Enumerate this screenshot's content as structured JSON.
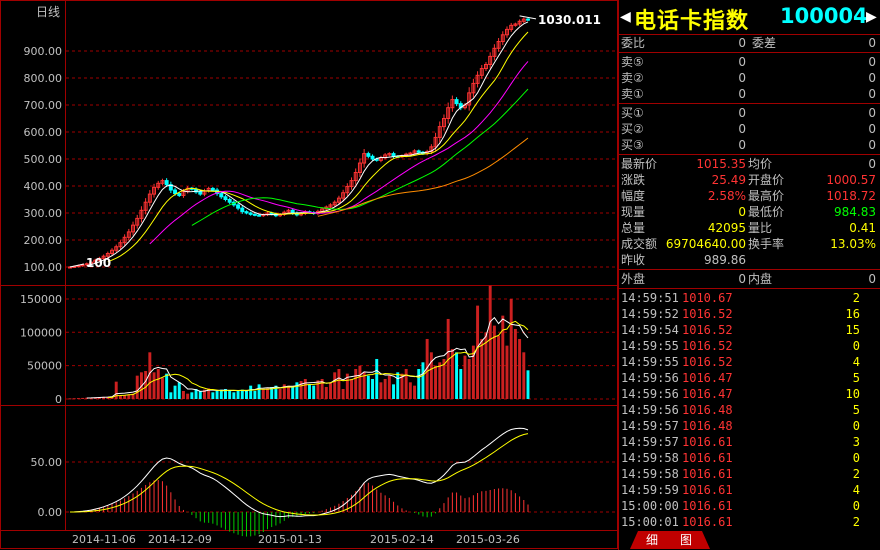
{
  "chart": {
    "period_label": "日线",
    "price_axis": [
      "900.00",
      "800.00",
      "700.00",
      "600.00",
      "500.00",
      "400.00",
      "300.00",
      "200.00",
      "100.00"
    ],
    "vol_axis": [
      "150000",
      "100000",
      "50000",
      "0"
    ],
    "macd_axis": [
      "50.00",
      "0.00"
    ],
    "dates": [
      "2014-11-06",
      "2014-12-09",
      "2015-01-13",
      "2015-02-14",
      "2015-03-26"
    ],
    "max_label": "1030.011",
    "min_label": "100",
    "colors": {
      "up": "#ff3333",
      "down": "#00ffff",
      "ma5": "#ffffff",
      "ma10": "#ffff00",
      "ma20": "#ff00ff",
      "ma30": "#00ff00",
      "ma60": "#ff8c00",
      "grid": "#a00000"
    }
  },
  "chart_data": {
    "type": "candlestick",
    "title": "日线",
    "close": [
      100,
      102,
      105,
      108,
      112,
      118,
      125,
      132,
      140,
      150,
      162,
      175,
      190,
      210,
      230,
      255,
      280,
      310,
      340,
      370,
      395,
      410,
      420,
      405,
      385,
      372,
      365,
      380,
      392,
      388,
      378,
      370,
      382,
      391,
      385,
      372,
      360,
      350,
      340,
      330,
      318,
      305,
      300,
      295,
      292,
      290,
      294,
      300,
      296,
      290,
      295,
      303,
      310,
      300,
      293,
      298,
      305,
      302,
      298,
      306,
      315,
      322,
      330,
      340,
      355,
      375,
      398,
      420,
      450,
      485,
      520,
      510,
      500,
      495,
      505,
      515,
      520,
      510,
      508,
      512,
      518,
      522,
      530,
      525,
      520,
      528,
      545,
      580,
      620,
      650,
      690,
      720,
      705,
      690,
      700,
      745,
      780,
      810,
      835,
      850,
      880,
      910,
      935,
      960,
      980,
      995,
      1000,
      1010,
      1018,
      1015
    ],
    "vol": [
      1000,
      1200,
      1400,
      1600,
      2000,
      2200,
      2500,
      3000,
      3200,
      3500,
      4000,
      26000,
      5000,
      6000,
      7000,
      8000,
      35000,
      40000,
      42000,
      70000,
      40000,
      45000,
      32000,
      38000,
      10000,
      20000,
      25000,
      12000,
      8000,
      10000,
      15000,
      12000,
      14000,
      16000,
      10000,
      12000,
      14000,
      15000,
      13000,
      10000,
      12000,
      14000,
      13000,
      20000,
      12000,
      22000,
      15000,
      16000,
      18000,
      20000,
      15000,
      22000,
      20000,
      18000,
      25000,
      27000,
      30000,
      22000,
      20000,
      28000,
      30000,
      18000,
      25000,
      40000,
      45000,
      15000,
      38000,
      30000,
      45000,
      50000,
      40000,
      35000,
      30000,
      60000,
      25000,
      30000,
      35000,
      22000,
      40000,
      38000,
      45000,
      25000,
      20000,
      45000,
      55000,
      90000,
      70000,
      50000,
      55000,
      60000,
      120000,
      75000,
      70000,
      45000,
      65000,
      60000,
      80000,
      140000,
      90000,
      100000,
      170000,
      110000,
      95000,
      125000,
      80000,
      150000,
      105000,
      90000,
      70000,
      43000
    ],
    "ylim": [
      100,
      1040
    ]
  },
  "panel": {
    "name": "电话卡指数",
    "code": "100004",
    "order": [
      {
        "l": "委比",
        "v": "0",
        "l2": "委差",
        "v2": "0"
      }
    ],
    "asks": [
      {
        "l": "卖⑤",
        "p": "0",
        "q": "0"
      },
      {
        "l": "卖②",
        "p": "0",
        "q": "0"
      },
      {
        "l": "卖①",
        "p": "0",
        "q": "0"
      }
    ],
    "bids": [
      {
        "l": "买①",
        "p": "0",
        "q": "0"
      },
      {
        "l": "买②",
        "p": "0",
        "q": "0"
      },
      {
        "l": "买③",
        "p": "0",
        "q": "0"
      }
    ],
    "quote": [
      {
        "l": "最新价",
        "v": "1015.35",
        "c": "#ff3333",
        "l2": "均价",
        "v2": "0",
        "c2": "#c0c0c0"
      },
      {
        "l": "涨跌",
        "v": "25.49",
        "c": "#ff3333",
        "l2": "开盘价",
        "v2": "1000.57",
        "c2": "#ff3333"
      },
      {
        "l": "幅度",
        "v": "2.58%",
        "c": "#ff3333",
        "l2": "最高价",
        "v2": "1018.72",
        "c2": "#ff3333"
      },
      {
        "l": "现量",
        "v": "0",
        "c": "#ffff00",
        "l2": "最低价",
        "v2": "984.83",
        "c2": "#00ff00"
      },
      {
        "l": "总量",
        "v": "42095",
        "c": "#ffff00",
        "l2": "量比",
        "v2": "0.41",
        "c2": "#ffff00"
      },
      {
        "l": "成交额",
        "v": "69704640.00",
        "c": "#ffff00",
        "l2": "换手率",
        "v2": "13.03%",
        "c2": "#ffff00"
      },
      {
        "l": "昨收",
        "v": "989.86",
        "c": "#c0c0c0",
        "l2": "",
        "v2": "",
        "c2": "#c0c0c0"
      }
    ],
    "outin": {
      "l": "外盘",
      "v": "0",
      "l2": "内盘",
      "v2": "0"
    },
    "ticks": [
      {
        "t": "14:59:51",
        "p": "1010.67",
        "q": "2"
      },
      {
        "t": "14:59:52",
        "p": "1016.52",
        "q": "16"
      },
      {
        "t": "14:59:54",
        "p": "1016.52",
        "q": "15"
      },
      {
        "t": "14:59:55",
        "p": "1016.52",
        "q": "0"
      },
      {
        "t": "14:59:55",
        "p": "1016.52",
        "q": "4"
      },
      {
        "t": "14:59:56",
        "p": "1016.47",
        "q": "5"
      },
      {
        "t": "14:59:56",
        "p": "1016.47",
        "q": "10"
      },
      {
        "t": "14:59:56",
        "p": "1016.48",
        "q": "5"
      },
      {
        "t": "14:59:57",
        "p": "1016.48",
        "q": "0"
      },
      {
        "t": "14:59:57",
        "p": "1016.61",
        "q": "3"
      },
      {
        "t": "14:59:58",
        "p": "1016.61",
        "q": "0"
      },
      {
        "t": "14:59:58",
        "p": "1016.61",
        "q": "2"
      },
      {
        "t": "14:59:59",
        "p": "1016.61",
        "q": "4"
      },
      {
        "t": "15:00:00",
        "p": "1016.61",
        "q": "0"
      },
      {
        "t": "15:00:01",
        "p": "1016.61",
        "q": "2"
      }
    ],
    "tabs": {
      "detail": "细",
      "chart": "图"
    }
  }
}
